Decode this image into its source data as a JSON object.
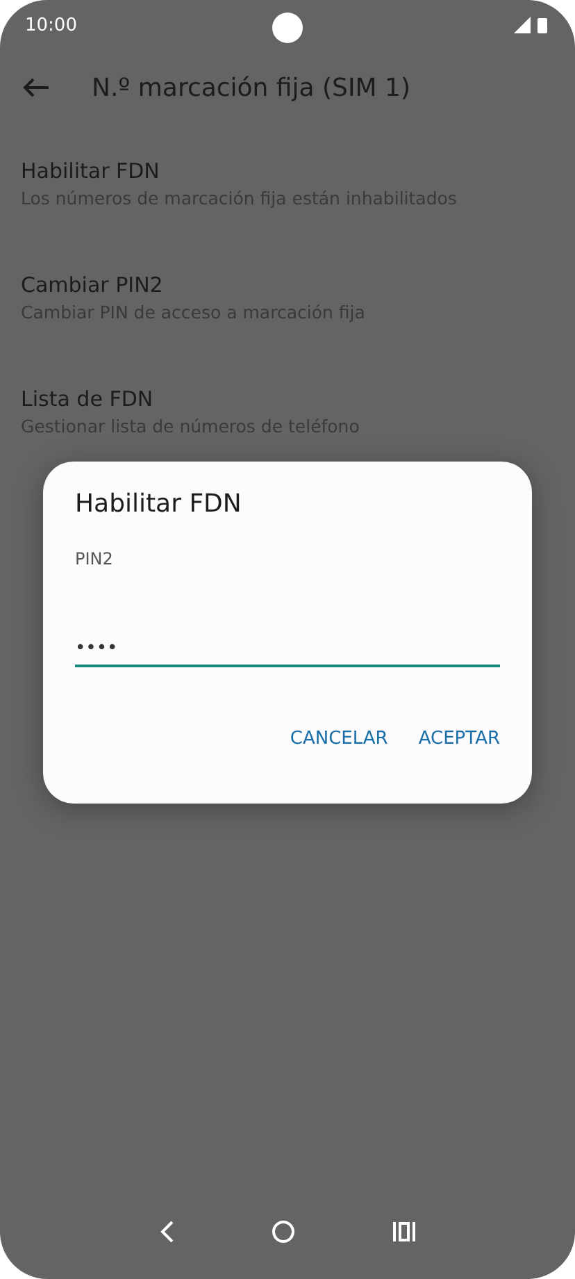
{
  "status_bar": {
    "time": "10:00"
  },
  "toolbar": {
    "title": "N.º marcación fija (SIM 1)"
  },
  "settings": [
    {
      "title": "Habilitar FDN",
      "summary": "Los números de marcación fija están inhabilitados"
    },
    {
      "title": "Cambiar PIN2",
      "summary": "Cambiar PIN de acceso a marcación fija"
    },
    {
      "title": "Lista de FDN",
      "summary": "Gestionar lista de números de teléfono"
    }
  ],
  "dialog": {
    "title": "Habilitar FDN",
    "label": "PIN2",
    "value": "••••",
    "buttons": [
      "CANCELAR",
      "ACEPTAR"
    ]
  }
}
